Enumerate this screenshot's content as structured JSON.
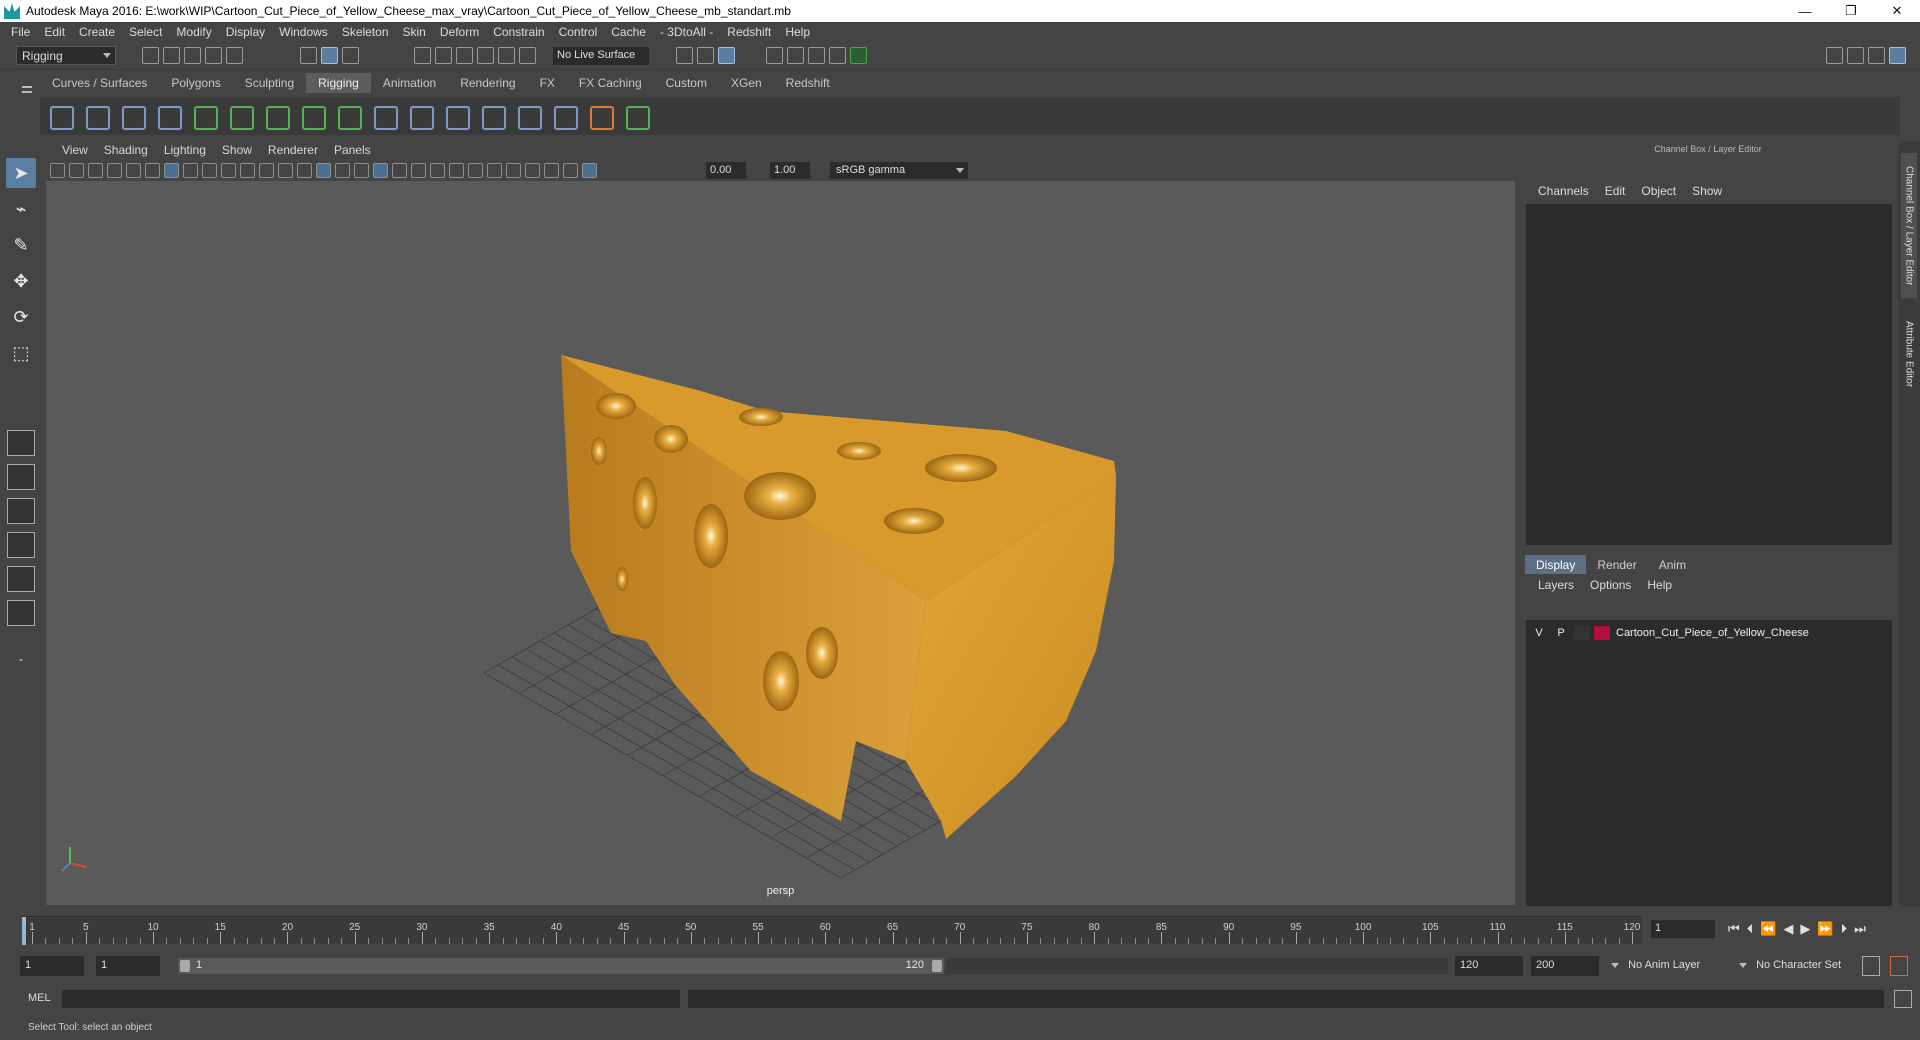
{
  "window": {
    "title": "Autodesk Maya 2016: E:\\work\\WIP\\Cartoon_Cut_Piece_of_Yellow_Cheese_max_vray\\Cartoon_Cut_Piece_of_Yellow_Cheese_mb_standart.mb",
    "controls": [
      "—",
      "❐",
      "✕"
    ]
  },
  "menubar": [
    "File",
    "Edit",
    "Create",
    "Select",
    "Modify",
    "Display",
    "Windows",
    "Skeleton",
    "Skin",
    "Deform",
    "Constrain",
    "Control",
    "Cache",
    "- 3DtoAll -",
    "Redshift",
    "Help"
  ],
  "statusline": {
    "mode": "Rigging",
    "live_surface": "No Live Surface"
  },
  "shelf": {
    "tabs": [
      "Curves / Surfaces",
      "Polygons",
      "Sculpting",
      "Rigging",
      "Animation",
      "Rendering",
      "FX",
      "FX Caching",
      "Custom",
      "XGen",
      "Redshift"
    ],
    "active_tab": "Rigging",
    "tool_icons": [
      "joint-tool-icon",
      "ik-handle-icon",
      "ik-spline-icon",
      "insert-joint-icon",
      "mirror-joint-icon",
      "bind-skin-icon",
      "smooth-skin-icon",
      "lattice-icon",
      "cluster-icon",
      "orient-constraint-icon",
      "parent-constraint-icon",
      "point-constraint-icon",
      "aim-constraint-icon",
      "pole-vector-icon",
      "scale-constraint-icon",
      "locator-icon",
      "hik-icon"
    ]
  },
  "viewport": {
    "menu": [
      "View",
      "Shading",
      "Lighting",
      "Show",
      "Renderer",
      "Panels"
    ],
    "exposure": "0.00",
    "gamma_value": "1.00",
    "color_space": "sRGB gamma",
    "camera": "persp"
  },
  "channel_box": {
    "title": "Channel Box / Layer Editor",
    "menu": [
      "Channels",
      "Edit",
      "Object",
      "Show"
    ]
  },
  "layer_editor": {
    "tabs": [
      "Display",
      "Render",
      "Anim"
    ],
    "active_tab": "Display",
    "menu": [
      "Layers",
      "Options",
      "Help"
    ],
    "layers": [
      {
        "visible": "V",
        "playback": "P",
        "color": "#b0103a",
        "name": "Cartoon_Cut_Piece_of_Yellow_Cheese"
      }
    ]
  },
  "side_tabs": [
    "Channel Box / Layer Editor",
    "Attribute Editor"
  ],
  "time_slider": {
    "start": 1,
    "end": 120,
    "labels": [
      1,
      5,
      10,
      15,
      20,
      25,
      30,
      35,
      40,
      45,
      50,
      55,
      60,
      65,
      70,
      75,
      80,
      85,
      90,
      95,
      100,
      105,
      110,
      115,
      120
    ],
    "current_frame": "1"
  },
  "range_slider": {
    "start_time": "1",
    "playback_start": "1",
    "range_low": "1",
    "range_high": "120",
    "playback_end": "120",
    "end_time": "200",
    "anim_layer": "No Anim Layer",
    "character_set": "No Character Set"
  },
  "command_line": {
    "label": "MEL"
  },
  "help_line": "Select Tool: select an object"
}
